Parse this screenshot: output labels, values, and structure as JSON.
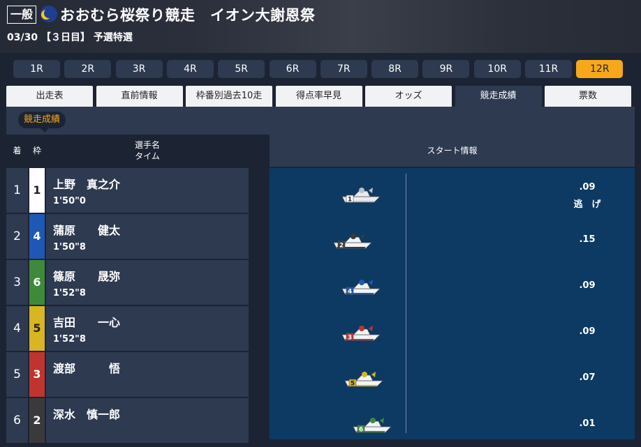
{
  "header": {
    "grade": "一般",
    "title": "おおむら桜祭り競走　イオン大謝恩祭",
    "subtitle": "03/30 【３日目】 予選特選"
  },
  "race_tabs": [
    {
      "label": "1R"
    },
    {
      "label": "2R"
    },
    {
      "label": "3R"
    },
    {
      "label": "4R"
    },
    {
      "label": "5R"
    },
    {
      "label": "6R"
    },
    {
      "label": "7R"
    },
    {
      "label": "8R"
    },
    {
      "label": "9R"
    },
    {
      "label": "10R"
    },
    {
      "label": "11R"
    },
    {
      "label": "12R"
    }
  ],
  "active_race": "12R",
  "info_tabs": [
    {
      "label": "出走表"
    },
    {
      "label": "直前情報"
    },
    {
      "label": "枠番別過去10走"
    },
    {
      "label": "得点率早見"
    },
    {
      "label": "オッズ"
    },
    {
      "label": "競走成績"
    },
    {
      "label": "票数"
    }
  ],
  "active_info_tab": "競走成績",
  "sub_label": "競走成績",
  "table_head": {
    "rank": "着",
    "frame": "枠",
    "name": "選手名",
    "time": "タイム"
  },
  "start_head": "スタート情報",
  "frame_colors": {
    "1": {
      "bg": "#ffffff",
      "fg": "#222222"
    },
    "2": {
      "bg": "#3a3a3a",
      "fg": "#ffffff"
    },
    "3": {
      "bg": "#c0342f",
      "fg": "#ffffff"
    },
    "4": {
      "bg": "#1f57b4",
      "fg": "#ffffff"
    },
    "5": {
      "bg": "#d8b522",
      "fg": "#222222"
    },
    "6": {
      "bg": "#3f8a3a",
      "fg": "#ffffff"
    }
  },
  "results": [
    {
      "rank": "1",
      "frame": "1",
      "name": "上野　真之介",
      "time": "1'50\"0"
    },
    {
      "rank": "2",
      "frame": "4",
      "name": "蒲原　　健太",
      "time": "1'50\"8"
    },
    {
      "rank": "3",
      "frame": "6",
      "name": "篠原　　晟弥",
      "time": "1'52\"8"
    },
    {
      "rank": "4",
      "frame": "5",
      "name": "吉田　　一心",
      "time": "1'52\"8"
    },
    {
      "rank": "5",
      "frame": "3",
      "name": "渡部　　　悟",
      "time": ""
    },
    {
      "rank": "6",
      "frame": "2",
      "name": "深水　慎一郎",
      "time": ""
    }
  ],
  "starts": [
    {
      "boat": "1",
      "st": ".09",
      "note": "逃　げ"
    },
    {
      "boat": "2",
      "st": ".15",
      "note": ""
    },
    {
      "boat": "4",
      "st": ".09",
      "note": ""
    },
    {
      "boat": "3",
      "st": ".09",
      "note": ""
    },
    {
      "boat": "5",
      "st": ".07",
      "note": ""
    },
    {
      "boat": "6",
      "st": ".01",
      "note": ""
    }
  ]
}
